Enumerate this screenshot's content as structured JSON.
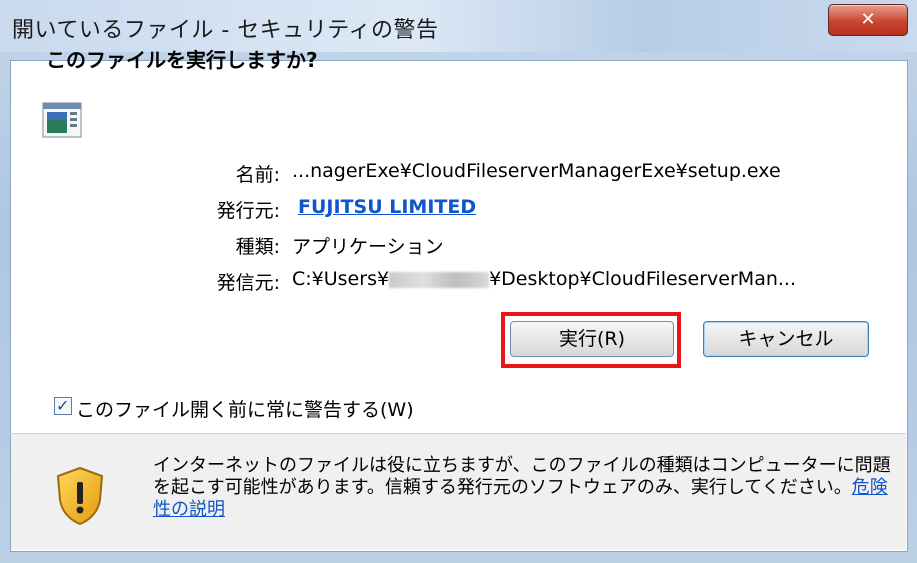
{
  "window": {
    "title": "開いているファイル - セキュリティの警告"
  },
  "dialog": {
    "heading": "このファイルを実行しますか?",
    "fields": [
      {
        "label": "名前:",
        "value": "...nagerExe¥CloudFileserverManagerExe¥setup.exe"
      },
      {
        "label": "発行元:",
        "value": "FUJITSU LIMITED"
      },
      {
        "label": "種類:",
        "value": "アプリケーション"
      },
      {
        "label": "発信元:",
        "value_prefix": "C:¥Users¥",
        "value_suffix": "¥Desktop¥CloudFileserverMan..."
      }
    ],
    "run_button": "実行(R)",
    "cancel_button": "キャンセル",
    "checkbox": {
      "label": "このファイル開く前に常に警告する(W)",
      "checked": true
    },
    "warning": {
      "text": "インターネットのファイルは役に立ちますが、このファイルの種類はコンピューターに問題を起こす可能性があります。信頼する発行元のソフトウェアのみ、実行してください。",
      "link": "危険性の説明"
    }
  },
  "colors": {
    "highlight": "#e8151b",
    "link": "#1155cc"
  }
}
